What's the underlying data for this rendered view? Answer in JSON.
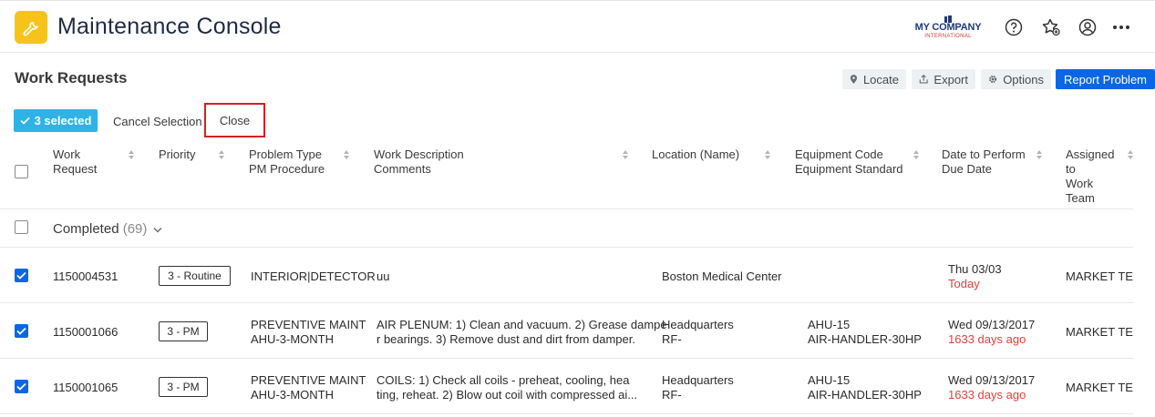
{
  "header": {
    "app_title": "Maintenance Console",
    "brand_name": "MY COMPANY",
    "brand_sub": "INTERNATIONAL",
    "icons": [
      "wrench-icon",
      "help-icon",
      "favorites-star-icon",
      "user-icon",
      "more-icon"
    ]
  },
  "section": {
    "title": "Work Requests",
    "locate_label": "Locate",
    "export_label": "Export",
    "options_label": "Options",
    "report_label": "Report Problem"
  },
  "selection": {
    "badge_label": "3 selected",
    "cancel_label": "Cancel Selection",
    "close_label": "Close"
  },
  "columns": {
    "work_request": [
      "Work",
      "Request"
    ],
    "priority": "Priority",
    "problem_type": [
      "Problem Type",
      "PM Procedure"
    ],
    "work_description": [
      "Work Description",
      "Comments"
    ],
    "location": "Location (Name)",
    "equipment": [
      "Equipment Code",
      "Equipment Standard"
    ],
    "date": [
      "Date to Perform",
      "Due Date"
    ],
    "assigned": [
      "Assigned",
      "to",
      "Work",
      "Team"
    ]
  },
  "group": {
    "label": "Completed",
    "count": "(69)"
  },
  "rows": [
    {
      "id": "1150004531",
      "priority": "3 - Routine",
      "problem": [
        "INTERIOR|DETECTOR",
        ""
      ],
      "description": [
        "uu",
        ""
      ],
      "location": [
        "Boston Medical Center",
        ""
      ],
      "equipment": [
        "",
        ""
      ],
      "date": "Thu 03/03",
      "due": "Today",
      "assigned": "MARKET TEAM"
    },
    {
      "id": "1150001066",
      "priority": "3 - PM",
      "problem": [
        "PREVENTIVE MAINT",
        "AHU-3-MONTH"
      ],
      "description": [
        "AIR PLENUM: 1) Clean and vacuum. 2) Grease dampe",
        "r bearings. 3) Remove dust and dirt from damper."
      ],
      "location": [
        "Headquarters",
        "RF-"
      ],
      "equipment": [
        "AHU-15",
        "AIR-HANDLER-30HP"
      ],
      "date": "Wed 09/13/2017",
      "due": "1633 days ago",
      "assigned": "MARKET TEAM"
    },
    {
      "id": "1150001065",
      "priority": "3 - PM",
      "problem": [
        "PREVENTIVE MAINT",
        "AHU-3-MONTH"
      ],
      "description": [
        "COILS: 1) Check all coils - preheat, cooling, hea",
        "ting, reheat. 2) Blow out coil with compressed ai..."
      ],
      "location": [
        "Headquarters",
        "RF-"
      ],
      "equipment": [
        "AHU-15",
        "AIR-HANDLER-30HP"
      ],
      "date": "Wed 09/13/2017",
      "due": "1633 days ago",
      "assigned": "MARKET TEAM"
    }
  ],
  "colors": {
    "accent": "#0a66e4",
    "selection_badge": "#2fb3e6",
    "logo": "#f6c31b",
    "overdue": "#e0413a",
    "highlight_outline": "#d62020"
  }
}
